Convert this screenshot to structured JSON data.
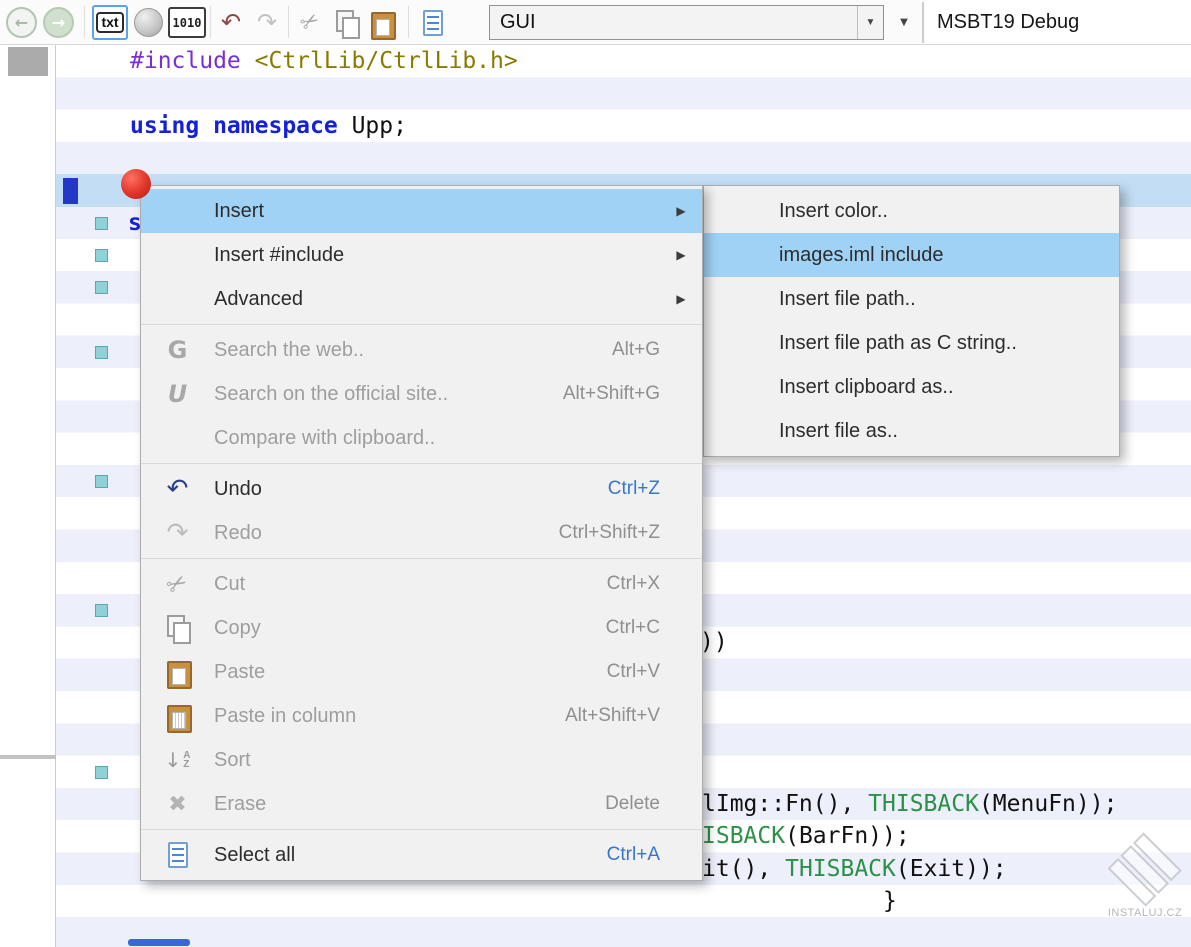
{
  "toolbar": {
    "file_type_button": "txt",
    "binary_button": "1010",
    "main_package_combo": "GUI",
    "build_method": "MSBT19 Debug"
  },
  "editor": {
    "line_include": {
      "directive": "#include",
      "path": " <CtrlLib/CtrlLib.h>"
    },
    "line_using": {
      "keywords": "using namespace ",
      "name": "Upp;"
    },
    "line_struct_partial": "s",
    "line_parens": "))",
    "line_menu_set": {
      "pre": "lImg::Fn(), ",
      "macro": "THISBACK",
      "post": "(MenuFn));"
    },
    "line_bar_set": {
      "macro": "ISBACK",
      "post": "(BarFn));"
    },
    "line_exit": {
      "pre": "it(), ",
      "macro": "THISBACK",
      "post": "(Exit));"
    },
    "line_close_brace": "}"
  },
  "context_menu": {
    "items": [
      {
        "label": "Insert",
        "submenu": true,
        "highlighted": true
      },
      {
        "label": "Insert #include",
        "submenu": true
      },
      {
        "label": "Advanced",
        "submenu": true
      },
      {
        "label": "Search the web..",
        "shortcut": "Alt+G",
        "icon": "google-g-icon"
      },
      {
        "label": "Search on the official site..",
        "shortcut": "Alt+Shift+G",
        "icon": "upp-u-icon"
      },
      {
        "label": "Compare with clipboard.."
      },
      {
        "label": "Undo",
        "shortcut": "Ctrl+Z",
        "icon": "undo-icon"
      },
      {
        "label": "Redo",
        "shortcut": "Ctrl+Shift+Z",
        "icon": "redo-icon"
      },
      {
        "label": "Cut",
        "shortcut": "Ctrl+X",
        "icon": "cut-icon"
      },
      {
        "label": "Copy",
        "shortcut": "Ctrl+C",
        "icon": "copy-icon"
      },
      {
        "label": "Paste",
        "shortcut": "Ctrl+V",
        "icon": "paste-icon"
      },
      {
        "label": "Paste in column",
        "shortcut": "Alt+Shift+V",
        "icon": "paste-column-icon"
      },
      {
        "label": "Sort",
        "icon": "sort-icon"
      },
      {
        "label": "Erase",
        "shortcut": "Delete",
        "icon": "erase-icon"
      },
      {
        "label": "Select all",
        "shortcut": "Ctrl+A",
        "icon": "document-icon"
      }
    ]
  },
  "submenu": {
    "items": [
      {
        "label": "Insert color.."
      },
      {
        "label": "images.iml include",
        "highlighted": true
      },
      {
        "label": "Insert file path.."
      },
      {
        "label": "Insert file path as C string.."
      },
      {
        "label": "Insert clipboard as.."
      },
      {
        "label": "Insert file as.."
      }
    ]
  },
  "glyphs": {
    "back": "←",
    "forward": "→",
    "undo": "↶",
    "redo": "↷",
    "cut": "✂",
    "erase": "✖",
    "google": "G",
    "upp": "U",
    "sort_arrow": "↓",
    "sort_a": "A",
    "sort_z": "Z",
    "dropdown": "▼",
    "submenu_arrow": "▶"
  },
  "colors": {
    "menu_highlight": "#9fd2f5",
    "shortcut_accent": "#3a76c8",
    "breakpoint_red": "#d8382b",
    "keyword_blue": "#1421d8",
    "preprocessor_purple": "#7a2fd4",
    "string_olive": "#8a7a00",
    "macro_green": "#2a9147",
    "current_line_blue": "#c3ddf4",
    "edit_marker_cyan": "#8ed1d6"
  },
  "watermark": {
    "caption": "INSTALUJ.CZ"
  }
}
